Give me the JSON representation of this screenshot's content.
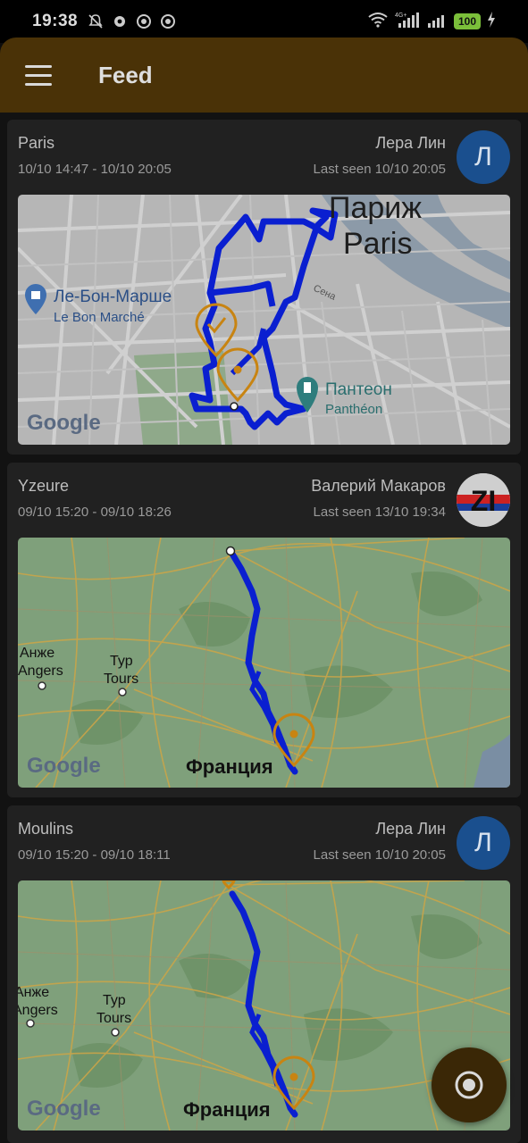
{
  "status_bar": {
    "time": "19:38",
    "battery": "100",
    "network": "4G+"
  },
  "app_bar": {
    "title": "Feed"
  },
  "feed": {
    "cards": [
      {
        "place": "Paris",
        "time_range": "10/10 14:47 - 10/10 20:05",
        "user": "Лера Лин",
        "last_seen": "Last seen 10/10 20:05",
        "avatar_letter": "Л",
        "map": {
          "city_ru": "Париж",
          "city_en": "Paris",
          "poi1_ru": "Ле-Бон-Марше",
          "poi1_en": "Le Bon Marché",
          "poi2_ru": "Пантеон",
          "poi2_en": "Panthéon",
          "river": "Сена",
          "google": "Google"
        }
      },
      {
        "place": "Yzeure",
        "time_range": "09/10 15:20 - 09/10 18:26",
        "user": "Валерий Макаров",
        "last_seen": "Last seen 13/10 19:34",
        "avatar_text": "ZI",
        "map": {
          "city1_ru": "Анже",
          "city1_en": "Angers",
          "city2_ru": "Тур",
          "city2_en": "Tours",
          "country": "Франция",
          "google": "Google"
        }
      },
      {
        "place": "Moulins",
        "time_range": "09/10 15:20 - 09/10 18:11",
        "user": "Лера Лин",
        "last_seen": "Last seen 10/10 20:05",
        "avatar_letter": "Л",
        "map": {
          "city1_ru": "Анже",
          "city1_en": "Angers",
          "city2_ru": "Тур",
          "city2_en": "Tours",
          "country": "Франция",
          "google": "Google"
        }
      }
    ]
  },
  "icons": {
    "menu": "menu-icon",
    "fab": "location-target-icon",
    "pin": "map-pin-icon",
    "check_pin": "map-pin-check-icon"
  },
  "colors": {
    "app_bar": "#4a3207",
    "route": "#0a1fd0",
    "pin": "#c88412",
    "avatar": "#1a4f8e"
  }
}
